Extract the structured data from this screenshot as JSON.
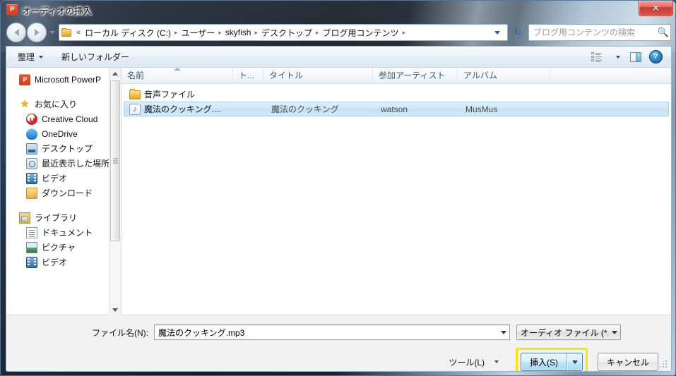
{
  "window": {
    "title": "オーディオの挿入",
    "app_icon": "powerpoint-icon",
    "close_label": "✕"
  },
  "address_bar": {
    "back_tooltip": "戻る",
    "forward_tooltip": "進む",
    "chevron": "«",
    "crumbs": [
      "ローカル ディスク (C:)",
      "ユーザー",
      "skyfish",
      "デスクトップ",
      "ブログ用コンテンツ"
    ],
    "separator": "▸",
    "refresh_icon": "refresh-icon"
  },
  "search": {
    "placeholder": "ブログ用コンテンツの検索",
    "value": "",
    "icon": "search-icon"
  },
  "command_bar": {
    "organize_label": "整理",
    "new_folder_label": "新しいフォルダー",
    "view_icon": "view-list-icon",
    "preview_pane_icon": "preview-pane-icon",
    "help_icon": "help-icon",
    "help_glyph": "?"
  },
  "nav_pane": {
    "items": [
      {
        "label": "Microsoft PowerP",
        "icon": "powerpoint-icon",
        "level": 0,
        "gap_after": true
      },
      {
        "label": "お気に入り",
        "icon": "star-icon",
        "level": 0
      },
      {
        "label": "Creative Cloud",
        "icon": "creative-cloud-icon",
        "level": 1
      },
      {
        "label": "OneDrive",
        "icon": "onedrive-icon",
        "level": 1
      },
      {
        "label": "デスクトップ",
        "icon": "desktop-icon",
        "level": 1
      },
      {
        "label": "最近表示した場所",
        "icon": "recent-places-icon",
        "level": 1
      },
      {
        "label": "ビデオ",
        "icon": "video-icon",
        "level": 1
      },
      {
        "label": "ダウンロード",
        "icon": "download-icon",
        "level": 1,
        "gap_after": true
      },
      {
        "label": "ライブラリ",
        "icon": "library-icon",
        "level": 0
      },
      {
        "label": "ドキュメント",
        "icon": "document-icon",
        "level": 1
      },
      {
        "label": "ピクチャ",
        "icon": "picture-icon",
        "level": 1
      },
      {
        "label": "ビデオ",
        "icon": "video-icon",
        "level": 1
      }
    ]
  },
  "file_list": {
    "columns": [
      {
        "label": "名前",
        "key": "name",
        "sorted": true
      },
      {
        "label": "ト...",
        "key": "track"
      },
      {
        "label": "タイトル",
        "key": "title"
      },
      {
        "label": "参加アーティスト",
        "key": "artist"
      },
      {
        "label": "アルバム",
        "key": "album"
      }
    ],
    "rows": [
      {
        "icon": "folder-icon",
        "name": "音声ファイル",
        "track": "",
        "title": "",
        "artist": "",
        "album": "",
        "selected": false
      },
      {
        "icon": "music-file-icon",
        "name": "魔法のクッキング....",
        "track": "",
        "title": "魔法のクッキング",
        "artist": "watson",
        "album": "MusMus",
        "selected": true
      }
    ]
  },
  "footer": {
    "filename_label": "ファイル名(N):",
    "filename_value": "魔法のクッキング.mp3",
    "filename_placeholder": "",
    "filetype_value": "オーディオ ファイル (*.adts;",
    "tools_label": "ツール(L)",
    "insert_label": "挿入(S)",
    "cancel_label": "キャンセル"
  },
  "colors": {
    "accent": "#3c7fb1",
    "highlight_ring": "#ffe400",
    "selection": "#c2e0f6",
    "column_header_text": "#3a5a7a"
  }
}
